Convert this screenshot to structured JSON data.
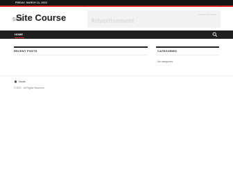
{
  "topbar": {
    "date": "FRIDAY, MARCH 11, 2022"
  },
  "header": {
    "site_title": "Site Course",
    "ghost_title": "SITE",
    "ad_label": "Advertisement",
    "ad_note": "ADVERTISE HERE"
  },
  "nav": {
    "home": "HOME"
  },
  "main": {
    "recent_posts_title": "RECENT POSTS"
  },
  "sidebar": {
    "categories_title": "CATEGORIES",
    "no_categories": "No categories"
  },
  "footer": {
    "breadcrumb_home": "Home",
    "copyright": "© 2021 - All Rights Reserved."
  },
  "colors": {
    "accent": "#e02b2b",
    "dark": "#1f1f1f"
  }
}
